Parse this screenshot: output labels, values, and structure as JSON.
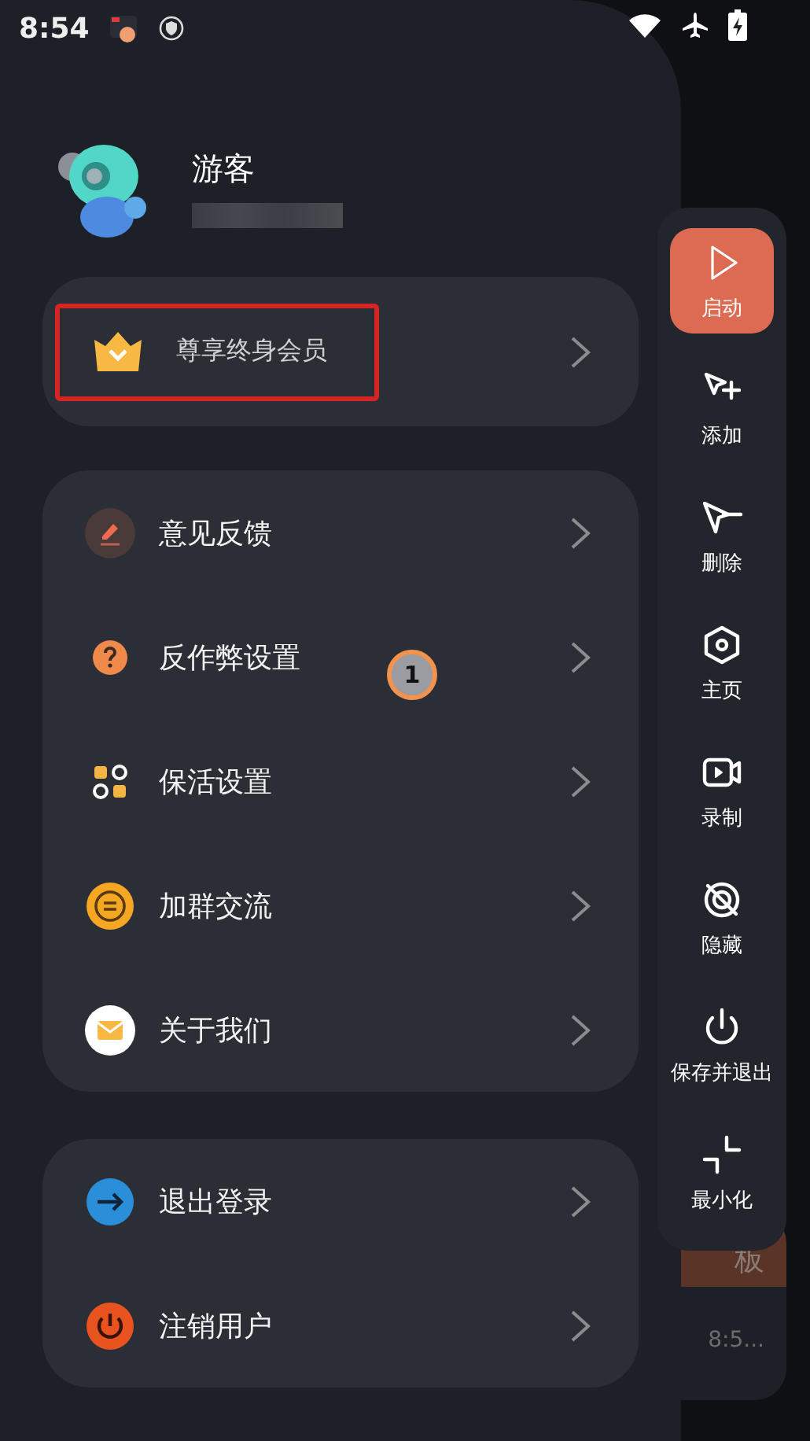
{
  "status_bar": {
    "time": "8:54"
  },
  "profile": {
    "name": "游客"
  },
  "membership": {
    "label": "尊享终身会员",
    "highlighted": true
  },
  "menu": [
    {
      "kind": "feedback",
      "label": "意见反馈"
    },
    {
      "kind": "question",
      "label": "反作弊设置"
    },
    {
      "kind": "grid",
      "label": "保活设置"
    },
    {
      "kind": "chat",
      "label": "加群交流"
    },
    {
      "kind": "mail",
      "label": "关于我们"
    }
  ],
  "account_menu": [
    {
      "kind": "logout",
      "label": "退出登录"
    },
    {
      "kind": "power",
      "label": "注销用户"
    }
  ],
  "touch_marker": {
    "label": "1"
  },
  "toolbar": [
    {
      "kind": "play",
      "label": "启动",
      "selected": true
    },
    {
      "kind": "add",
      "label": "添加",
      "selected": false
    },
    {
      "kind": "remove",
      "label": "删除",
      "selected": false
    },
    {
      "kind": "home",
      "label": "主页",
      "selected": false
    },
    {
      "kind": "record",
      "label": "录制",
      "selected": false
    },
    {
      "kind": "hide",
      "label": "隐藏",
      "selected": false
    },
    {
      "kind": "power",
      "label": "保存并退出",
      "selected": false
    },
    {
      "kind": "minimize",
      "label": "最小化",
      "selected": false
    }
  ],
  "background_cards": [
    {
      "title": "板",
      "time": "8:5..."
    }
  ]
}
